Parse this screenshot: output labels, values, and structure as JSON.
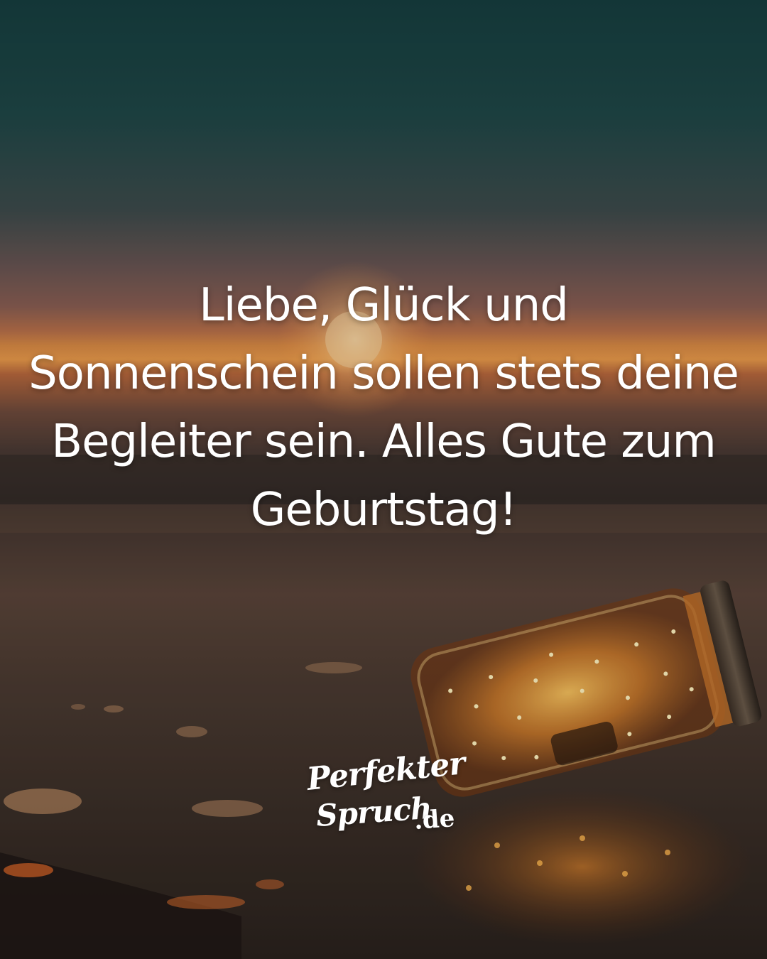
{
  "quote": {
    "lines": [
      "Liebe, Glück und",
      "Sonnenschein sollen stets deine",
      "Begleiter sein. Alles Gute zum",
      "Geburtstag!"
    ]
  },
  "logo": {
    "line1": "Perfekter",
    "line2": "Spruch",
    "line3": ".de"
  },
  "colors": {
    "text": "#ffffff",
    "sky_top": "#1c4a4a",
    "horizon_glow": "#f0a24a",
    "jar_glow": "#ffb84a",
    "water": "#3a3028"
  }
}
